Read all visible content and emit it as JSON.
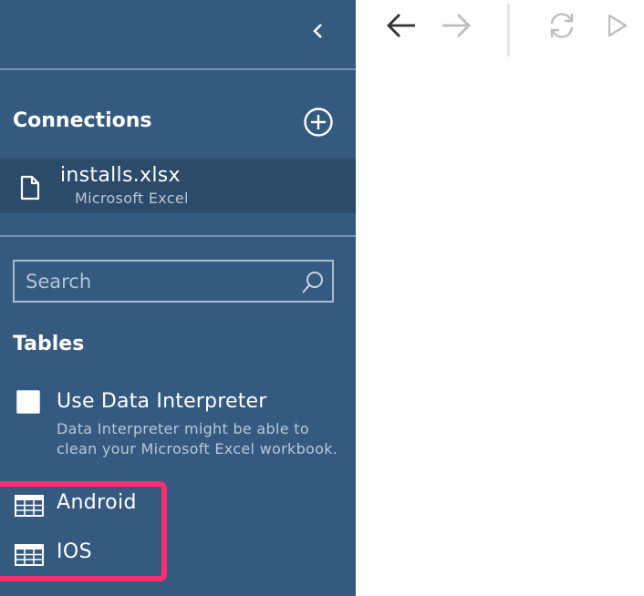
{
  "sidebar": {
    "collapse_icon": "chevron-left-icon",
    "connections": {
      "title": "Connections",
      "add_icon": "plus-circle-icon",
      "items": [
        {
          "name": "installs.xlsx",
          "type": "Microsoft Excel",
          "icon": "file-icon"
        }
      ]
    },
    "search": {
      "placeholder": "Search",
      "value": "",
      "icon": "search-icon"
    },
    "tables": {
      "title": "Tables",
      "interpreter": {
        "label": "Use Data Interpreter",
        "checked": false,
        "description": "Data Interpreter might be able to clean your Microsoft Excel workbook."
      },
      "items": [
        {
          "label": "Android",
          "icon": "table-icon"
        },
        {
          "label": "IOS",
          "icon": "table-icon"
        }
      ]
    }
  },
  "toolbar": {
    "buttons": [
      {
        "name": "back",
        "icon": "arrow-left-icon",
        "enabled": true
      },
      {
        "name": "forward",
        "icon": "arrow-right-icon",
        "enabled": false
      },
      {
        "name": "refresh",
        "icon": "refresh-icon",
        "enabled": false
      },
      {
        "name": "run",
        "icon": "play-icon",
        "enabled": false
      }
    ]
  },
  "colors": {
    "sidebar_bg": "#355a7f",
    "selected_connection_bg": "#2c4a69",
    "highlight": "#ff2d6f",
    "toolbar_active": "#333333",
    "toolbar_disabled": "#bdbdbd"
  }
}
